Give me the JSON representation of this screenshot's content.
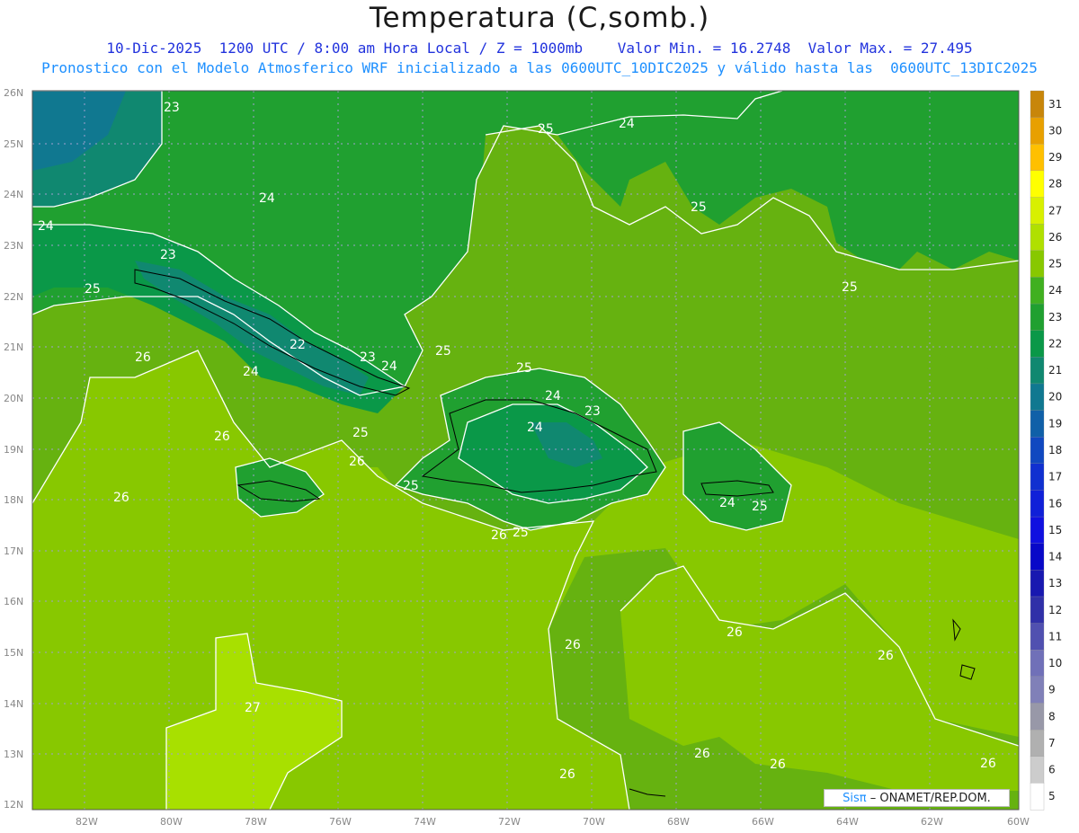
{
  "header": {
    "title": "Temperatura (C,somb.)",
    "line1": "10-Dic-2025  1200 UTC / 8:00 am Hora Local / Z = 1000mb    Valor Min. = 16.2748  Valor Max. = 27.495",
    "line2": "Pronostico con el Modelo Atmosferico WRF inicializado a las 0600UTC_10DIC2025 y válido hasta las  0600UTC_13DIC2025"
  },
  "axes": {
    "lat_labels": [
      "26N",
      "25N",
      "24N",
      "23N",
      "22N",
      "21N",
      "20N",
      "19N",
      "18N",
      "17N",
      "16N",
      "15N",
      "14N",
      "13N",
      "12N"
    ],
    "lon_labels": [
      "82W",
      "80W",
      "78W",
      "76W",
      "74W",
      "72W",
      "70W",
      "68W",
      "66W",
      "64W",
      "62W",
      "60W"
    ]
  },
  "contour_labels": [
    {
      "text": "23"
    },
    {
      "text": "24"
    },
    {
      "text": "24"
    },
    {
      "text": "25"
    },
    {
      "text": "24"
    },
    {
      "text": "25"
    },
    {
      "text": "23"
    },
    {
      "text": "25"
    },
    {
      "text": "22"
    },
    {
      "text": "23"
    },
    {
      "text": "24"
    },
    {
      "text": "24"
    },
    {
      "text": "25"
    },
    {
      "text": "26"
    },
    {
      "text": "26"
    },
    {
      "text": "26"
    },
    {
      "text": "26"
    },
    {
      "text": "25"
    },
    {
      "text": "25"
    },
    {
      "text": "24"
    },
    {
      "text": "23"
    },
    {
      "text": "24"
    },
    {
      "text": "25"
    },
    {
      "text": "26"
    },
    {
      "text": "25"
    },
    {
      "text": "24"
    },
    {
      "text": "25"
    },
    {
      "text": "25"
    },
    {
      "text": "26"
    },
    {
      "text": "26"
    },
    {
      "text": "27"
    },
    {
      "text": "26"
    },
    {
      "text": "26"
    },
    {
      "text": "26"
    },
    {
      "text": "26"
    },
    {
      "text": "26"
    }
  ],
  "colorbar": {
    "levels": [
      "31",
      "30",
      "29",
      "28",
      "27",
      "26",
      "25",
      "24",
      "23",
      "22",
      "21",
      "20",
      "19",
      "18",
      "17",
      "16",
      "15",
      "14",
      "13",
      "12",
      "11",
      "10",
      "9",
      "8",
      "7",
      "6",
      "5"
    ],
    "colors": [
      "#c8860a",
      "#e8a000",
      "#ffc000",
      "#ffff00",
      "#d8f000",
      "#b0e000",
      "#88c800",
      "#40b020",
      "#20a030",
      "#0a9848",
      "#108870",
      "#107890",
      "#1060a8",
      "#1048c0",
      "#1030d0",
      "#1020d8",
      "#1010e0",
      "#0808c8",
      "#1818b0",
      "#3030a8",
      "#5050b0",
      "#7070b8",
      "#8080b8",
      "#9898a8",
      "#b0b0b0",
      "#cccccc",
      "#ffffff"
    ]
  },
  "credit": {
    "sis": "Sisπ",
    "text": "– ONAMET/REP.DOM."
  }
}
